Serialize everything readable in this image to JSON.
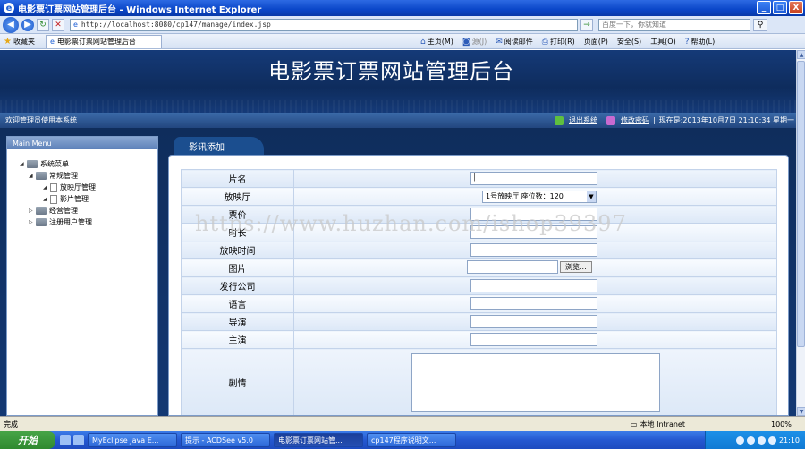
{
  "window": {
    "title": "电影票订票网站管理后台 - Windows Internet Explorer",
    "minimize": "_",
    "maximize": "□",
    "close": "X"
  },
  "addressbar": {
    "url": "http://localhost:8080/cp147/manage/index.jsp",
    "search_placeholder": "百度一下，你就知道"
  },
  "favbar": {
    "favorites": "收藏夹",
    "tab_title": "电影票订票网站管理后台",
    "commands": [
      "主页(M)",
      "源(J)",
      "阅读邮件",
      "打印(R)",
      "页面(P)",
      "安全(S)",
      "工具(O)",
      "帮助(L)"
    ]
  },
  "site": {
    "title": "电影票订票网站管理后台",
    "welcome": "欢迎管理员使用本系统",
    "logout": "退出系统",
    "change_password": "修改密码",
    "now_text": "现在是:2013年10月7日 21:10:34 星期一"
  },
  "menu": {
    "header": "Main Menu",
    "root": "系统菜单",
    "group1": "常规管理",
    "item1": "放映厅管理",
    "item2": "影片管理",
    "group2": "经营管理",
    "group3": "注册用户管理"
  },
  "panel": {
    "tab": "影讯添加"
  },
  "form": {
    "name_label": "片名",
    "hall_label": "放映厅",
    "hall_value": "1号放映厅  座位数：120",
    "price_label": "票价",
    "duration_label": "时长",
    "showtime_label": "放映时间",
    "image_label": "图片",
    "browse": "浏览...",
    "company_label": "发行公司",
    "language_label": "语言",
    "director_label": "导演",
    "actor_label": "主演",
    "plot_label": "剧情"
  },
  "watermark": "https://www.huzhan.com/ishop39397",
  "iestatus": {
    "done": "完成",
    "zone": "本地 Intranet",
    "zoom": "100%"
  },
  "taskbar": {
    "start": "开始",
    "tasks": [
      "MyEclipse Java E...",
      "提示 - ACDSee v5.0",
      "电影票订票网站管...",
      "cp147程序说明文..."
    ],
    "clock": "21:10"
  }
}
